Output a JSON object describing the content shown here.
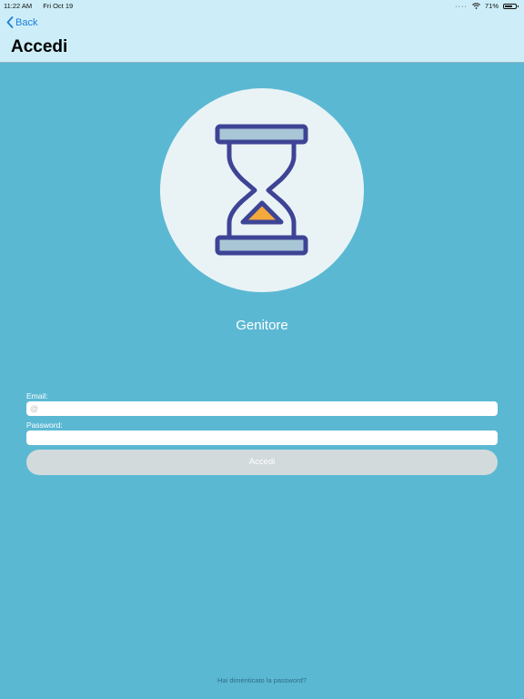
{
  "statusbar": {
    "time": "11:22 AM",
    "date": "Fri Oct 19",
    "battery": "71%",
    "battery_level": 0.71
  },
  "nav": {
    "back_label": "Back",
    "title": "Accedi"
  },
  "profile": {
    "role": "Genitore",
    "icon": "hourglass-icon"
  },
  "form": {
    "email_label": "Email:",
    "email_value": "",
    "email_placeholder": "@",
    "password_label": "Password:",
    "password_value": "",
    "submit_label": "Accedi"
  },
  "footer": {
    "forgot_label": "Hai dimenticato la password?"
  },
  "colors": {
    "background": "#5bb8d3",
    "navbar": "#cdeef8",
    "back_link": "#1a7fd8",
    "button_disabled": "#d2dadc",
    "hourglass_outline": "#3e4495",
    "sand": "#f3a93b"
  }
}
